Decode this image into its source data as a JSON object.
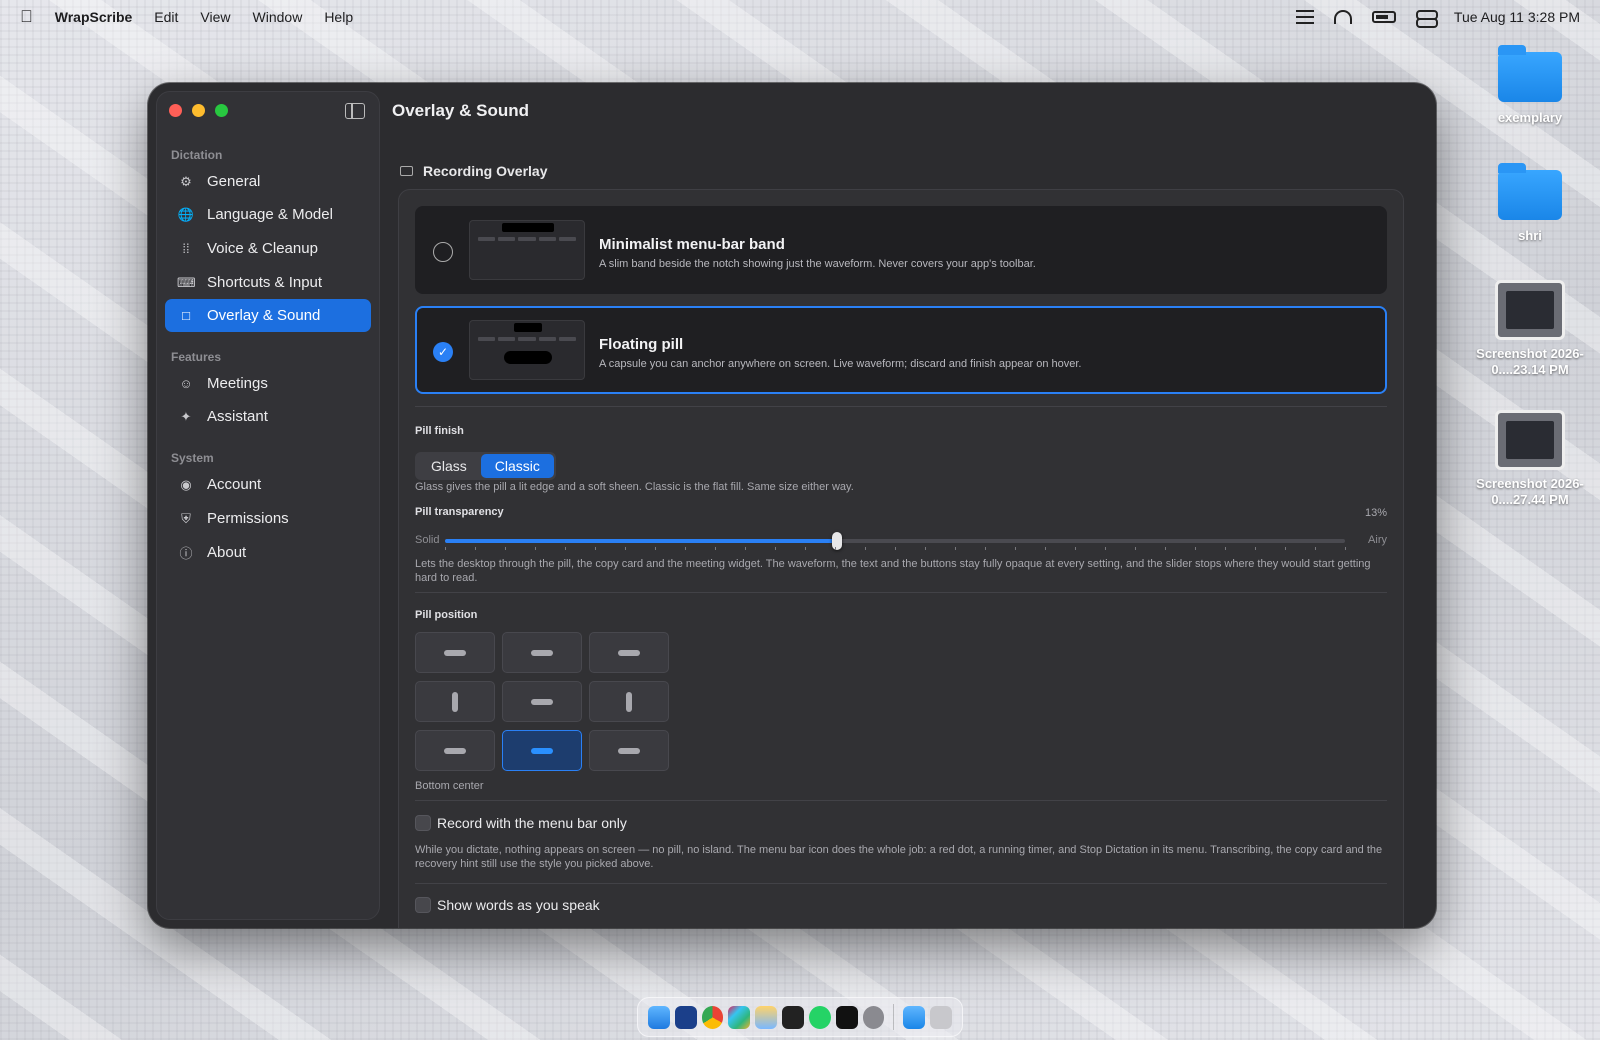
{
  "menubar": {
    "app_name": "WrapScribe",
    "menus": [
      "Edit",
      "View",
      "Window",
      "Help"
    ],
    "clock": "Tue Aug 11  3:28 PM"
  },
  "desktop": {
    "icons": [
      {
        "label": "exemplary",
        "type": "folder"
      },
      {
        "label": "shri",
        "type": "folder"
      },
      {
        "label": "Screenshot 2026-0....23.14 PM",
        "type": "screenshot"
      },
      {
        "label": "Screenshot 2026-0....27.44 PM",
        "type": "screenshot"
      }
    ]
  },
  "sidebar": {
    "sections": [
      {
        "title": "Dictation",
        "items": [
          {
            "label": "General",
            "icon": "gear-icon"
          },
          {
            "label": "Language & Model",
            "icon": "globe-icon"
          },
          {
            "label": "Voice & Cleanup",
            "icon": "waveform-icon"
          },
          {
            "label": "Shortcuts & Input",
            "icon": "keyboard-icon"
          },
          {
            "label": "Overlay & Sound",
            "icon": "overlay-icon",
            "active": true
          }
        ]
      },
      {
        "title": "Features",
        "items": [
          {
            "label": "Meetings",
            "icon": "people-icon"
          },
          {
            "label": "Assistant",
            "icon": "sparkle-icon"
          }
        ]
      },
      {
        "title": "System",
        "items": [
          {
            "label": "Account",
            "icon": "person-circle-icon"
          },
          {
            "label": "Permissions",
            "icon": "shield-icon"
          },
          {
            "label": "About",
            "icon": "info-icon"
          }
        ]
      }
    ]
  },
  "main": {
    "title": "Overlay & Sound",
    "section_title": "Recording Overlay",
    "options": [
      {
        "title": "Minimalist menu-bar band",
        "desc": "A slim band beside the notch showing just the waveform. Never covers your app's toolbar.",
        "selected": false
      },
      {
        "title": "Floating pill",
        "desc": "A capsule you can anchor anywhere on screen. Live waveform; discard and finish appear on hover.",
        "selected": true
      }
    ],
    "pill_finish": {
      "label": "Pill finish",
      "options": [
        "Glass",
        "Classic"
      ],
      "selected": "Classic",
      "help": "Glass gives the pill a lit edge and a soft sheen. Classic is the flat fill. Same size either way."
    },
    "pill_transparency": {
      "label": "Pill transparency",
      "value_text": "13%",
      "value_fraction": 0.435,
      "min_label": "Solid",
      "max_label": "Airy",
      "help": "Lets the desktop through the pill, the copy card and the meeting widget. The waveform, the text and the buttons stay fully opaque at every setting, and the slider stops where they would start getting hard to read."
    },
    "pill_position": {
      "label": "Pill position",
      "selected_label": "Bottom center",
      "selected_index": 7
    },
    "menu_bar_only": {
      "label": "Record with the menu bar only",
      "checked": false,
      "help": "While you dictate, nothing appears on screen — no pill, no island. The menu bar icon does the whole job: a red dot, a running timer, and Stop Dictation in its menu. Transcribing, the copy card and the recovery hint still use the style you picked above."
    },
    "show_words": {
      "label": "Show words as you speak",
      "checked": false
    }
  },
  "colors": {
    "accent": "#1c6fe0",
    "window_bg": "#2c2c2f",
    "close": "#ff5f57",
    "minimize": "#febc2e",
    "zoom": "#28c840"
  }
}
